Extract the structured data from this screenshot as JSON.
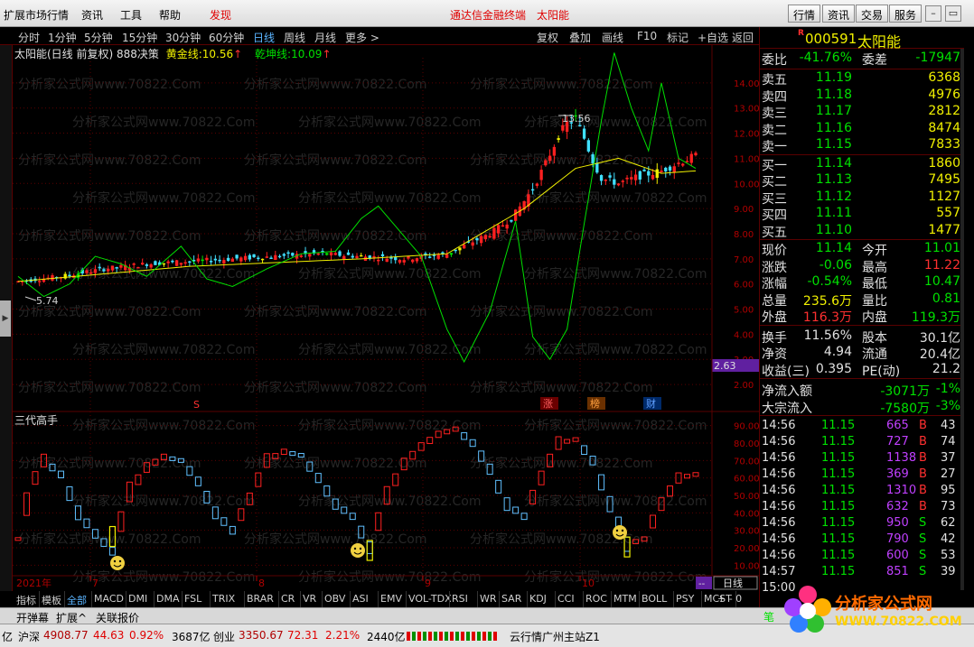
{
  "menubar": {
    "items": [
      "扩展市场行情",
      "资讯",
      "工具",
      "帮助",
      "发现"
    ],
    "center_left": "通达信金融终端",
    "center_right": "太阳能",
    "right_buttons": [
      "行情",
      "资讯",
      "交易",
      "服务"
    ]
  },
  "periodbar": {
    "items": [
      "分时",
      "1分钟",
      "5分钟",
      "15分钟",
      "30分钟",
      "60分钟",
      "日线",
      "周线",
      "月线",
      "更多 >"
    ],
    "active": "日线",
    "tools": [
      "复权",
      "叠加",
      "画线",
      "F10",
      "标记",
      "+自选",
      "返回"
    ]
  },
  "info": {
    "title": "太阳能(日线 前复权) 888决策",
    "gold_label": "黄金线:",
    "gold_value": "10.56",
    "qk_label": "乾坤线:",
    "qk_value": "10.09"
  },
  "chart_labels": {
    "watermark": "分析家公式网www.70822.Com",
    "high_label": "13.56",
    "low_label": "5.74",
    "main_y_ticks": [
      "14.00",
      "13.00",
      "12.00",
      "11.00",
      "10.00",
      "9.00",
      "8.00",
      "7.00",
      "6.00",
      "5.00",
      "4.00",
      "3.00",
      "2.00"
    ],
    "side_value": "2.63",
    "markers": [
      "S",
      "涨",
      "榜",
      "财"
    ],
    "sub_title": "三代高手",
    "sub_y_ticks": [
      "90.00",
      "80.00",
      "70.00",
      "60.00",
      "50.00",
      "40.00",
      "30.00",
      "20.00",
      "10.00"
    ],
    "dates": [
      "2021年",
      "7",
      "8",
      "9",
      "10"
    ],
    "period_box": "日线",
    "mid_right": "--"
  },
  "chart_data": {
    "type": "candlestick",
    "main": {
      "y_range": [
        1.5,
        15.0
      ],
      "close_points": [
        [
          0,
          6.1
        ],
        [
          10,
          6.3
        ],
        [
          20,
          6.6
        ],
        [
          30,
          6.8
        ],
        [
          40,
          6.9
        ],
        [
          50,
          7.0
        ],
        [
          60,
          7.1
        ],
        [
          70,
          7.2
        ],
        [
          80,
          7.1
        ],
        [
          90,
          7.0
        ],
        [
          100,
          7.2
        ],
        [
          105,
          7.6
        ],
        [
          110,
          8.0
        ],
        [
          115,
          8.6
        ],
        [
          118,
          9.3
        ],
        [
          120,
          9.8
        ],
        [
          123,
          10.8
        ],
        [
          126,
          11.9
        ],
        [
          128,
          12.4
        ],
        [
          130,
          12.6
        ],
        [
          132,
          11.8
        ],
        [
          134,
          10.9
        ],
        [
          136,
          10.2
        ],
        [
          140,
          10.0
        ],
        [
          145,
          10.3
        ],
        [
          150,
          10.5
        ],
        [
          155,
          10.9
        ],
        [
          158,
          11.1
        ]
      ],
      "gold_line": [
        [
          0,
          6.1
        ],
        [
          40,
          6.7
        ],
        [
          80,
          7.0
        ],
        [
          100,
          7.2
        ],
        [
          118,
          9.0
        ],
        [
          130,
          10.6
        ],
        [
          140,
          11.0
        ],
        [
          150,
          10.4
        ],
        [
          158,
          10.5
        ]
      ],
      "qk_line": [
        [
          0,
          6.3
        ],
        [
          6,
          5.5
        ],
        [
          12,
          6.0
        ],
        [
          18,
          7.1
        ],
        [
          24,
          6.8
        ],
        [
          30,
          6.3
        ],
        [
          38,
          7.5
        ],
        [
          44,
          6.2
        ],
        [
          50,
          5.9
        ],
        [
          58,
          6.6
        ],
        [
          66,
          7.2
        ],
        [
          74,
          7.3
        ],
        [
          80,
          8.6
        ],
        [
          84,
          9.1
        ],
        [
          88,
          8.3
        ],
        [
          94,
          7.1
        ],
        [
          100,
          4.2
        ],
        [
          104,
          2.9
        ],
        [
          110,
          4.9
        ],
        [
          116,
          8.5
        ],
        [
          120,
          3.9
        ],
        [
          124,
          3.0
        ],
        [
          128,
          4.2
        ],
        [
          132,
          8.4
        ],
        [
          136,
          12.5
        ],
        [
          139,
          15.2
        ],
        [
          143,
          13.0
        ],
        [
          147,
          11.3
        ],
        [
          150,
          14.0
        ],
        [
          154,
          11.0
        ],
        [
          158,
          10.6
        ]
      ],
      "high_price": 13.56,
      "low_price": 5.74
    },
    "sub": {
      "y_range": [
        5,
        95
      ],
      "values": [
        [
          0,
          25
        ],
        [
          3,
          55
        ],
        [
          6,
          70
        ],
        [
          10,
          62
        ],
        [
          14,
          40
        ],
        [
          18,
          28
        ],
        [
          22,
          18
        ],
        [
          26,
          52
        ],
        [
          30,
          66
        ],
        [
          34,
          72
        ],
        [
          38,
          70
        ],
        [
          42,
          58
        ],
        [
          46,
          40
        ],
        [
          50,
          30
        ],
        [
          54,
          48
        ],
        [
          58,
          70
        ],
        [
          62,
          75
        ],
        [
          66,
          73
        ],
        [
          70,
          60
        ],
        [
          74,
          45
        ],
        [
          78,
          38
        ],
        [
          82,
          20
        ],
        [
          86,
          50
        ],
        [
          90,
          68
        ],
        [
          94,
          78
        ],
        [
          98,
          85
        ],
        [
          102,
          88
        ],
        [
          106,
          80
        ],
        [
          110,
          65
        ],
        [
          114,
          45
        ],
        [
          118,
          38
        ],
        [
          122,
          60
        ],
        [
          126,
          80
        ],
        [
          130,
          82
        ],
        [
          134,
          70
        ],
        [
          138,
          45
        ],
        [
          142,
          22
        ],
        [
          146,
          25
        ],
        [
          150,
          45
        ],
        [
          154,
          60
        ],
        [
          158,
          62
        ]
      ]
    }
  },
  "indicator_tabs": [
    "指标",
    "模板",
    "全部",
    "MACD",
    "DMI",
    "DMA",
    "FSL",
    "TRIX",
    "BRAR",
    "CR",
    "VR",
    "OBV",
    "ASI",
    "EMV",
    "VOL-TDX",
    "RSI",
    "WR",
    "SAR",
    "KDJ",
    "CCI",
    "ROC",
    "MTM",
    "BOLL",
    "PSY",
    "MCST"
  ],
  "indicator_active": "全部",
  "subbar": [
    "开弹幕",
    "扩展^",
    "关联报价"
  ],
  "statusbar": {
    "yi": "亿",
    "hs_label": "沪深",
    "hs_index": "4908.77",
    "hs_change": "44.63",
    "hs_pct": "0.92%",
    "hs_amount": "3687亿",
    "cy_label": "创业",
    "cy_index": "3350.67",
    "cy_change": "72.31",
    "cy_pct": "2.21%",
    "cy_amount": "2440亿",
    "server": "云行情广州主站Z1"
  },
  "panel": {
    "code": "000591",
    "name": "太阳能",
    "flag": "R",
    "weibi_label": "委比",
    "weibi_value": "-41.76%",
    "weicha_label": "委差",
    "weicha_value": "-17947",
    "sells": [
      {
        "label": "卖五",
        "price": "11.19",
        "vol": "6368"
      },
      {
        "label": "卖四",
        "price": "11.18",
        "vol": "4976"
      },
      {
        "label": "卖三",
        "price": "11.17",
        "vol": "2812"
      },
      {
        "label": "卖二",
        "price": "11.16",
        "vol": "8474"
      },
      {
        "label": "卖一",
        "price": "11.15",
        "vol": "7833"
      }
    ],
    "buys": [
      {
        "label": "买一",
        "price": "11.14",
        "vol": "1860"
      },
      {
        "label": "买二",
        "price": "11.13",
        "vol": "7495"
      },
      {
        "label": "买三",
        "price": "11.12",
        "vol": "1127"
      },
      {
        "label": "买四",
        "price": "11.11",
        "vol": "557"
      },
      {
        "label": "买五",
        "price": "11.10",
        "vol": "1477"
      }
    ],
    "stats": [
      {
        "l1": "现价",
        "v1": "11.14",
        "c1": "#00e000",
        "l2": "今开",
        "v2": "11.01",
        "c2": "#00e000"
      },
      {
        "l1": "涨跌",
        "v1": "-0.06",
        "c1": "#00e000",
        "l2": "最高",
        "v2": "11.22",
        "c2": "#ff3030"
      },
      {
        "l1": "涨幅",
        "v1": "-0.54%",
        "c1": "#00e000",
        "l2": "最低",
        "v2": "10.47",
        "c2": "#00e000"
      },
      {
        "l1": "总量",
        "v1": "235.6万",
        "c1": "#f0f000",
        "l2": "量比",
        "v2": "0.81",
        "c2": "#00e000"
      },
      {
        "l1": "外盘",
        "v1": "116.3万",
        "c1": "#ff3030",
        "l2": "内盘",
        "v2": "119.3万",
        "c2": "#00e000"
      }
    ],
    "stats2": [
      {
        "l1": "换手",
        "v1": "11.56%",
        "c1": "#e0e0e0",
        "l2": "股本",
        "v2": "30.1亿",
        "c2": "#e0e0e0"
      },
      {
        "l1": "净资",
        "v1": "4.94",
        "c1": "#e0e0e0",
        "l2": "流通",
        "v2": "20.4亿",
        "c2": "#e0e0e0"
      },
      {
        "l1": "收益(三)",
        "v1": "0.395",
        "c1": "#e0e0e0",
        "l2": "PE(动)",
        "v2": "21.2",
        "c2": "#e0e0e0"
      }
    ],
    "flow": [
      {
        "label": "净流入额",
        "v": "-3071万",
        "pct": "-1%"
      },
      {
        "label": "大宗流入",
        "v": "-7580万",
        "pct": "-3%"
      }
    ],
    "ticks": [
      {
        "t": "14:56",
        "p": "11.15",
        "v": "665",
        "s": "B",
        "n": "43"
      },
      {
        "t": "14:56",
        "p": "11.15",
        "v": "727",
        "s": "B",
        "n": "74"
      },
      {
        "t": "14:56",
        "p": "11.15",
        "v": "1138",
        "s": "B",
        "n": "37"
      },
      {
        "t": "14:56",
        "p": "11.15",
        "v": "369",
        "s": "B",
        "n": "27"
      },
      {
        "t": "14:56",
        "p": "11.15",
        "v": "1310",
        "s": "B",
        "n": "95"
      },
      {
        "t": "14:56",
        "p": "11.15",
        "v": "632",
        "s": "B",
        "n": "73"
      },
      {
        "t": "14:56",
        "p": "11.15",
        "v": "950",
        "s": "S",
        "n": "62"
      },
      {
        "t": "14:56",
        "p": "11.15",
        "v": "790",
        "s": "S",
        "n": "42"
      },
      {
        "t": "14:56",
        "p": "11.15",
        "v": "600",
        "s": "S",
        "n": "53"
      },
      {
        "t": "14:57",
        "p": "11.15",
        "v": "851",
        "s": "S",
        "n": "39"
      },
      {
        "t": "15:00",
        "p": "",
        "v": "",
        "s": "",
        "n": ""
      }
    ],
    "bottom_left": "笔"
  },
  "logo": {
    "text": "分析家公式网",
    "url": "WWW.70822.COM"
  },
  "colors": {
    "up": "#ff2020",
    "down": "#00e000",
    "cyan_bar": "#40e0ff",
    "gold_line": "#f0f000",
    "qk_line": "#00e000",
    "grid": "#5a0000"
  }
}
